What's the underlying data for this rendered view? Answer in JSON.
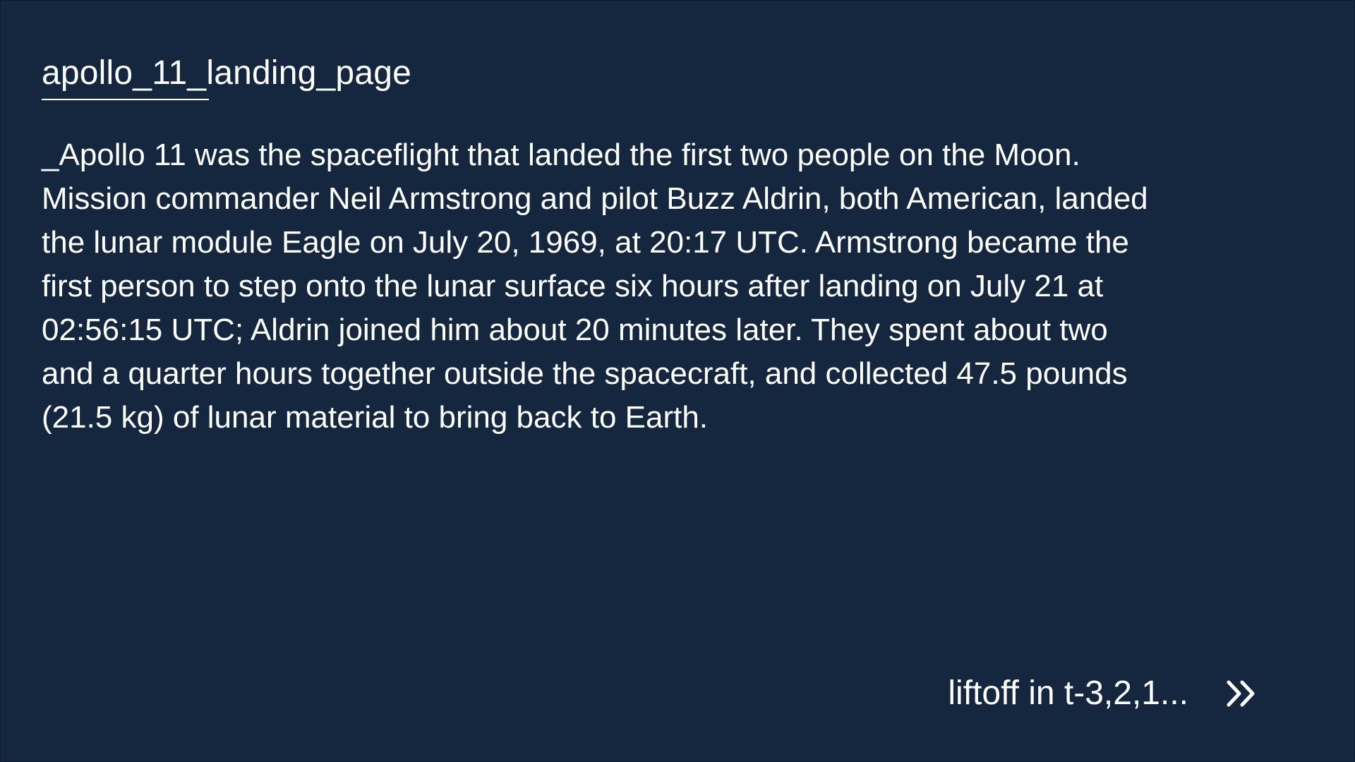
{
  "page": {
    "title": "apollo_11_landing_page"
  },
  "main": {
    "intro": "_Apollo 11 was the spaceflight that landed the first two people on the Moon. Mission commander Neil Armstrong and pilot Buzz Aldrin, both American, landed the lunar module Eagle on July 20, 1969, at 20:17 UTC. Armstrong became the first person to step onto the lunar surface six hours after landing on July 21 at 02:56:15 UTC; Aldrin joined him about 20 minutes later. They spent about two and a quarter hours together outside the spacecraft, and collected 47.5 pounds (21.5 kg) of lunar material to bring back to Earth."
  },
  "cta": {
    "label": "liftoff in t-3,2,1...",
    "icon": "double-chevron-right-icon"
  },
  "colors": {
    "background": "#14273f",
    "text": "#ffffff"
  }
}
